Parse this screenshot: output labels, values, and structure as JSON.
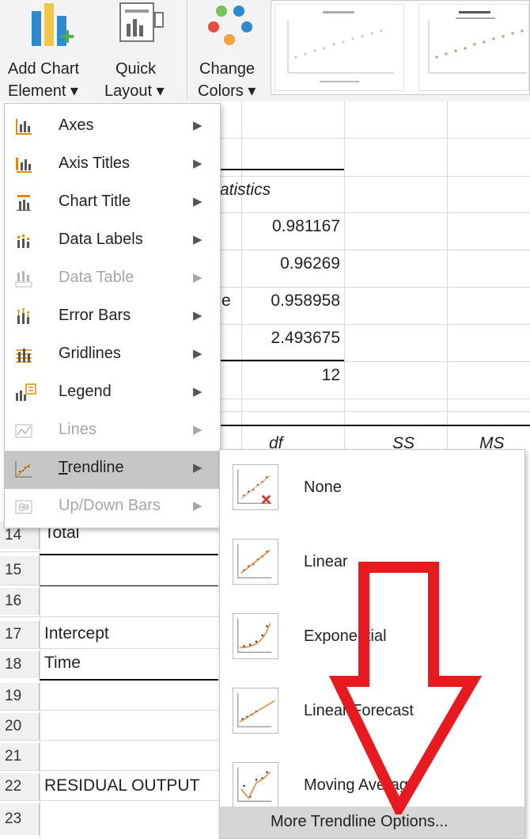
{
  "ribbon": {
    "add_chart_element": {
      "line1": "Add Chart",
      "line2": "Element ▾"
    },
    "quick_layout": {
      "line1": "Quick",
      "line2": "Layout ▾"
    },
    "change_colors": {
      "line1": "Change",
      "line2": "Colors ▾"
    },
    "accent": "#2b8bd1"
  },
  "menu": {
    "items": [
      {
        "label": "Axes",
        "icon": "axes-icon",
        "enabled": true
      },
      {
        "label": "Axis Titles",
        "icon": "axis-titles-icon",
        "enabled": true
      },
      {
        "label": "Chart Title",
        "icon": "chart-title-icon",
        "enabled": true
      },
      {
        "label": "Data Labels",
        "icon": "data-labels-icon",
        "enabled": true
      },
      {
        "label": "Data Table",
        "icon": "data-table-icon",
        "enabled": false
      },
      {
        "label": "Error Bars",
        "icon": "error-bars-icon",
        "enabled": true
      },
      {
        "label": "Gridlines",
        "icon": "gridlines-icon",
        "enabled": true
      },
      {
        "label": "Legend",
        "icon": "legend-icon",
        "enabled": true
      },
      {
        "label": "Lines",
        "icon": "lines-icon",
        "enabled": false
      },
      {
        "label": "Trendline",
        "icon": "trendline-icon",
        "enabled": true,
        "selected": true
      },
      {
        "label": "Up/Down Bars",
        "icon": "up-down-bars-icon",
        "enabled": false
      }
    ],
    "arrow": "▶"
  },
  "submenu": {
    "items": [
      {
        "label": "None",
        "icon": "trendline-none-icon"
      },
      {
        "label": "Linear",
        "icon": "trendline-linear-icon"
      },
      {
        "label": "Exponential",
        "icon": "trendline-exponential-icon"
      },
      {
        "label": "Linear Forecast",
        "icon": "trendline-linear-forecast-icon"
      },
      {
        "label": "Moving Average",
        "icon": "trendline-moving-average-icon"
      }
    ],
    "more_options": "More Trendline Options...",
    "annotation_color": "#e8191f"
  },
  "sheet": {
    "stats_header": "atistics",
    "stats_values": [
      "0.981167",
      "0.96269",
      "0.958958",
      "2.493675",
      "12"
    ],
    "stats_suffix": "e",
    "anova_headers": {
      "df": "df",
      "ss": "SS",
      "ms": "MS"
    },
    "rows": [
      {
        "num": "14",
        "label": "Total"
      },
      {
        "num": "15",
        "label": ""
      },
      {
        "num": "16",
        "label": ""
      },
      {
        "num": "17",
        "label": "Intercept"
      },
      {
        "num": "18",
        "label": "Time"
      },
      {
        "num": "19",
        "label": ""
      },
      {
        "num": "20",
        "label": ""
      },
      {
        "num": "21",
        "label": ""
      },
      {
        "num": "22",
        "label": "RESIDUAL OUTPUT"
      },
      {
        "num": "23",
        "label": ""
      }
    ]
  }
}
